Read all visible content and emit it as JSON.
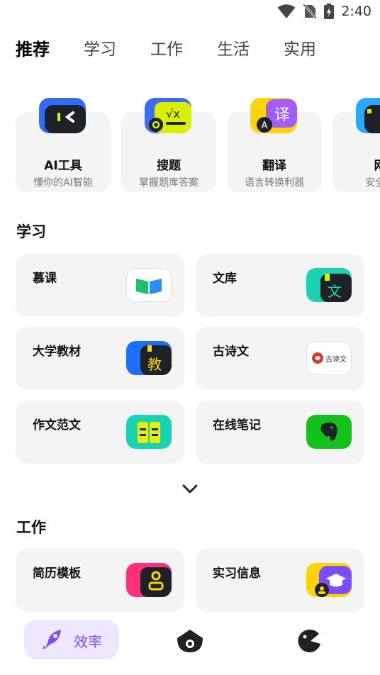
{
  "status_bar": {
    "time": "2:40"
  },
  "tabs": [
    {
      "label": "推荐"
    },
    {
      "label": "学习"
    },
    {
      "label": "工作"
    },
    {
      "label": "生活"
    },
    {
      "label": "实用"
    }
  ],
  "featured": [
    {
      "title": "AI工具",
      "subtitle": "懂你的AI智能",
      "icon": "ai-tool-icon"
    },
    {
      "title": "搜题",
      "subtitle": "掌握题库答案",
      "icon": "search-question-icon"
    },
    {
      "title": "翻译",
      "subtitle": "语言转换利器",
      "icon": "translate-icon"
    },
    {
      "title": "网",
      "subtitle": "安全高",
      "icon": "web-icon"
    }
  ],
  "sections": {
    "study": {
      "title": "学习",
      "items": [
        {
          "label": "慕课",
          "icon": "mooc-icon"
        },
        {
          "label": "文库",
          "icon": "library-icon"
        },
        {
          "label": "大学教材",
          "icon": "textbook-icon"
        },
        {
          "label": "古诗文",
          "icon": "poetry-icon",
          "icon_text": "古诗文"
        },
        {
          "label": "作文范文",
          "icon": "essay-icon"
        },
        {
          "label": "在线笔记",
          "icon": "evernote-icon"
        }
      ]
    },
    "work": {
      "title": "工作",
      "items": [
        {
          "label": "简历模板",
          "icon": "resume-icon"
        },
        {
          "label": "实习信息",
          "icon": "internship-icon"
        }
      ]
    }
  },
  "bottom_nav": [
    {
      "label": "效率",
      "icon": "rocket-icon",
      "active": true
    },
    {
      "label": "",
      "icon": "home-icon",
      "active": false
    },
    {
      "label": "",
      "icon": "game-icon",
      "active": false
    }
  ],
  "colors": {
    "accent": "#7a4dff",
    "highlight": "#ffe100",
    "card_bg": "#f4f4f5"
  }
}
